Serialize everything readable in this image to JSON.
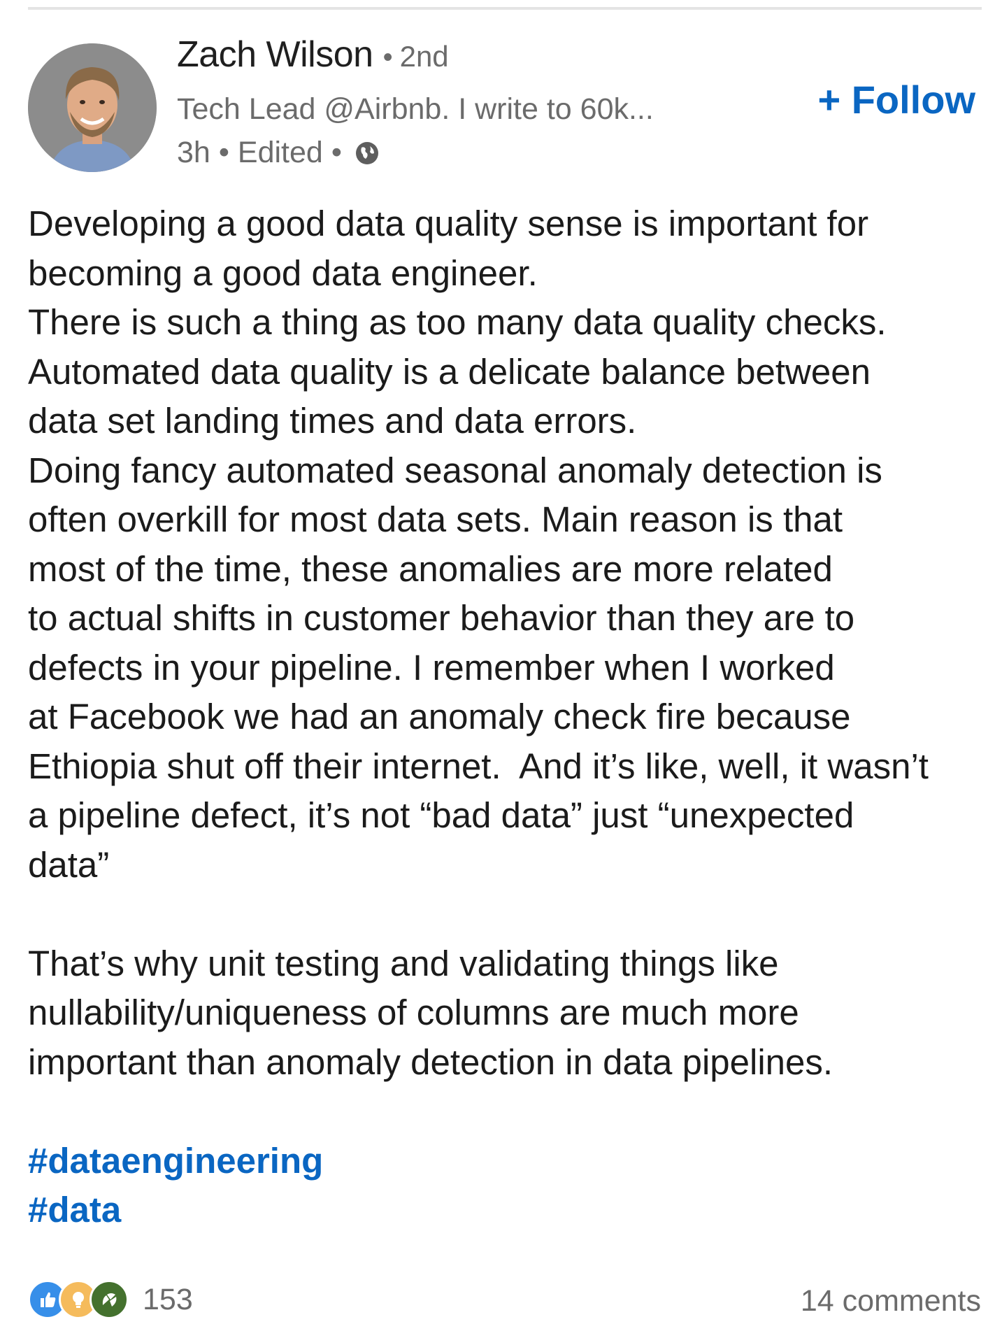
{
  "author": {
    "name": "Zach Wilson",
    "degree_separator": "•",
    "degree": "2nd",
    "headline": "Tech Lead @Airbnb. I write to 60k...",
    "time": "3h",
    "edited": "Edited",
    "meta_separator": "•",
    "visibility_icon": "globe-icon"
  },
  "follow": {
    "label": "+ Follow",
    "color": "#0a66c2"
  },
  "post": {
    "lines": [
      "Developing a good data quality sense is important for",
      "becoming a good data engineer.",
      "There is such a thing as too many data quality checks.",
      "Automated data quality is a delicate balance between",
      "data set landing times and data errors.",
      "Doing fancy automated seasonal anomaly detection is",
      "often overkill for most data sets. Main reason is that",
      "most of the time, these anomalies are more related",
      "to actual shifts in customer behavior than they are to",
      "defects in your pipeline. I remember when I worked",
      "at Facebook we had an anomaly check fire because",
      "Ethiopia shut off their internet.  And it’s like, well, it wasn’t",
      "a pipeline defect, it’s not “bad data” just “unexpected",
      "data”",
      "",
      "That’s why unit testing and validating things like",
      "nullability/uniqueness of columns are much more",
      "important than anomaly detection in data pipelines.",
      ""
    ],
    "hashtags": [
      "#dataengineering",
      "#data"
    ]
  },
  "social": {
    "reaction_icons": [
      "like-icon",
      "insightful-icon",
      "celebrate-icon"
    ],
    "reaction_count": "153",
    "comments": "14 comments"
  }
}
